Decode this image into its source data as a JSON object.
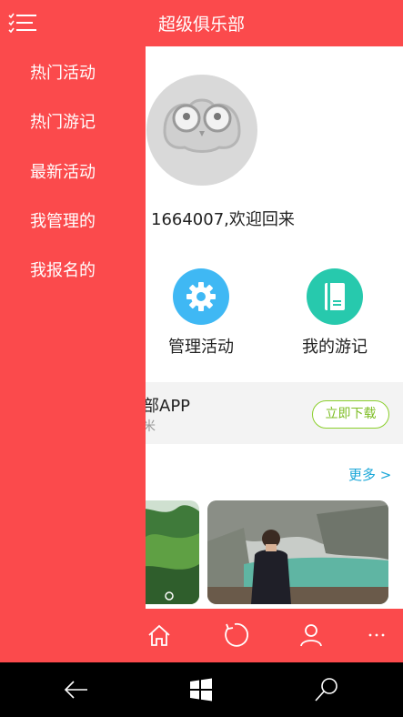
{
  "header": {
    "title": "超级俱乐部"
  },
  "drawer": {
    "items": [
      {
        "label": "热门活动"
      },
      {
        "label": "热门游记"
      },
      {
        "label": "最新活动"
      },
      {
        "label": "我管理的"
      },
      {
        "label": "我报名的"
      }
    ]
  },
  "profile": {
    "welcome": "1664007,欢迎回来"
  },
  "actions": [
    {
      "label": "管理活动",
      "icon": "gear-icon",
      "color": "#3fb8f4"
    },
    {
      "label": "我的游记",
      "icon": "notebook-icon",
      "color": "#27c9ad"
    }
  ],
  "banner": {
    "title": "部APP",
    "subtitle": "米",
    "button": "立即下载"
  },
  "travel": {
    "more": "更多 >"
  },
  "tabbar": {
    "icons": [
      "home-icon",
      "refresh-icon",
      "user-icon",
      "more-icon"
    ]
  },
  "colors": {
    "primary": "#fb4a4c",
    "download": "#8bcf2c",
    "link": "#1aa7d8"
  }
}
